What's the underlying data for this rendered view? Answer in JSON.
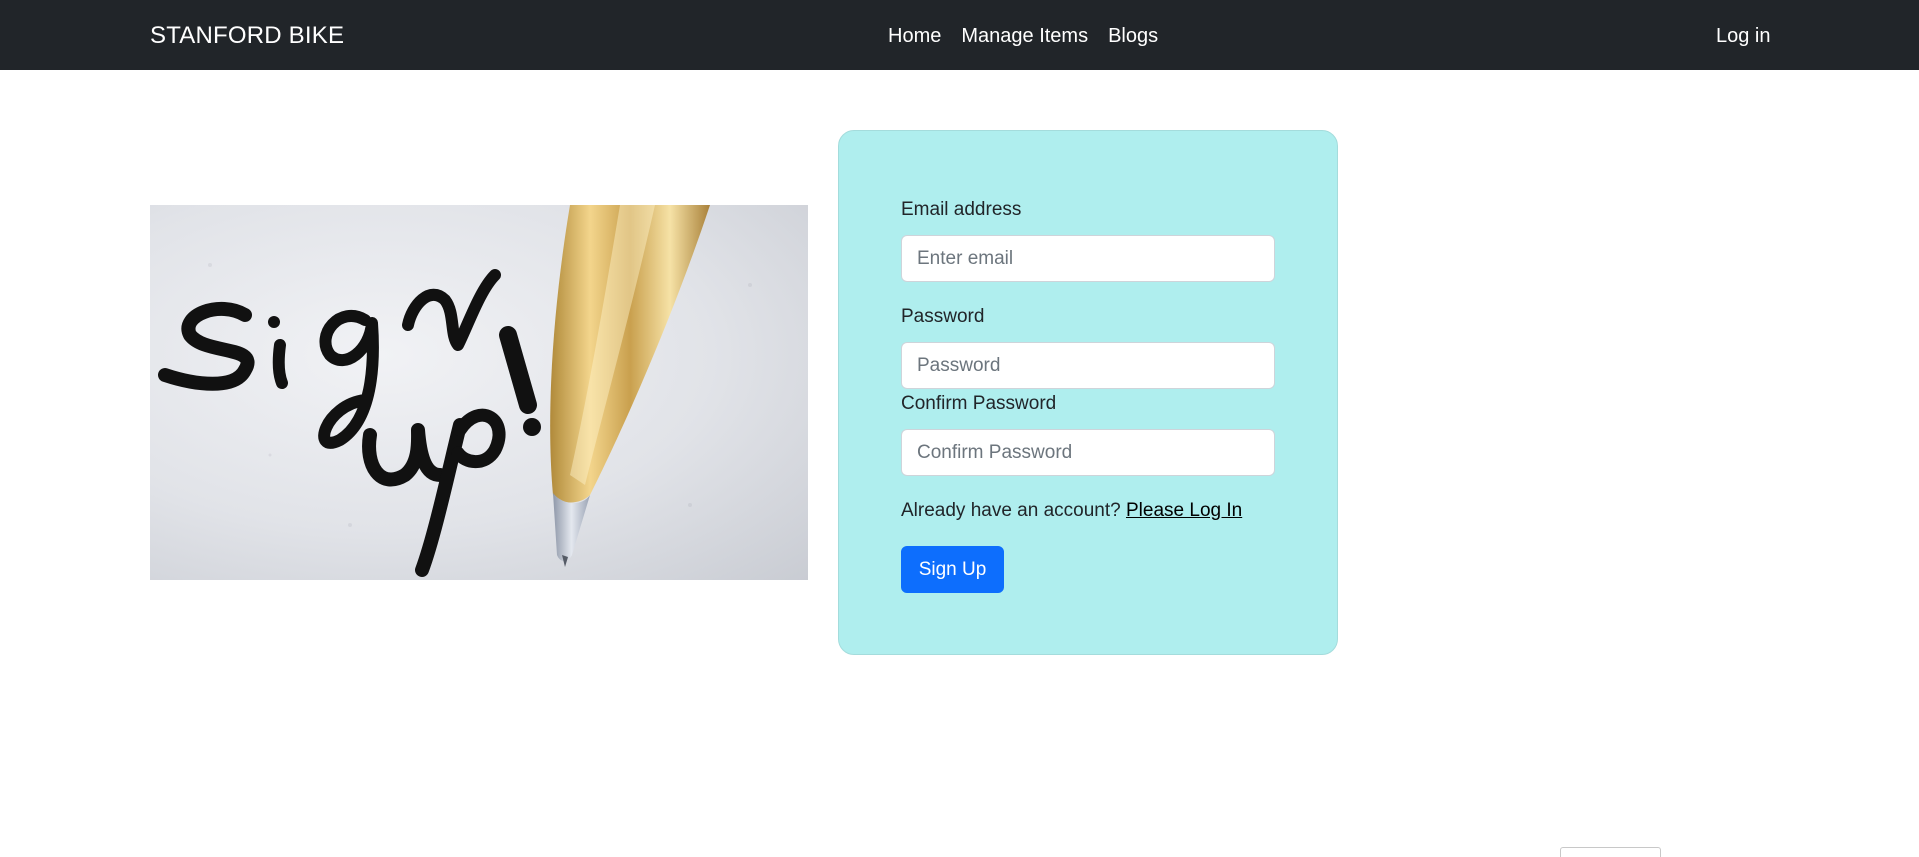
{
  "navbar": {
    "brand": "STANFORD BIKE",
    "links": [
      {
        "label": "Home"
      },
      {
        "label": "Manage Items"
      },
      {
        "label": "Blogs"
      }
    ],
    "login": "Log in",
    "background": "#212529"
  },
  "hero": {
    "image": "sign-up-pen-image",
    "handwriting_line1": "Sign",
    "handwriting_line2": "up!"
  },
  "form": {
    "background": "#afeeee",
    "email_label": "Email address",
    "email_placeholder": "Enter email",
    "password_label": "Password",
    "password_placeholder": "Password",
    "confirm_label": "Confirm Password",
    "confirm_placeholder": "Confirm Password",
    "already_text": "Already have an account?",
    "login_link": "Please Log In",
    "submit_label": "Sign Up",
    "submit_color": "#0d6efd"
  }
}
